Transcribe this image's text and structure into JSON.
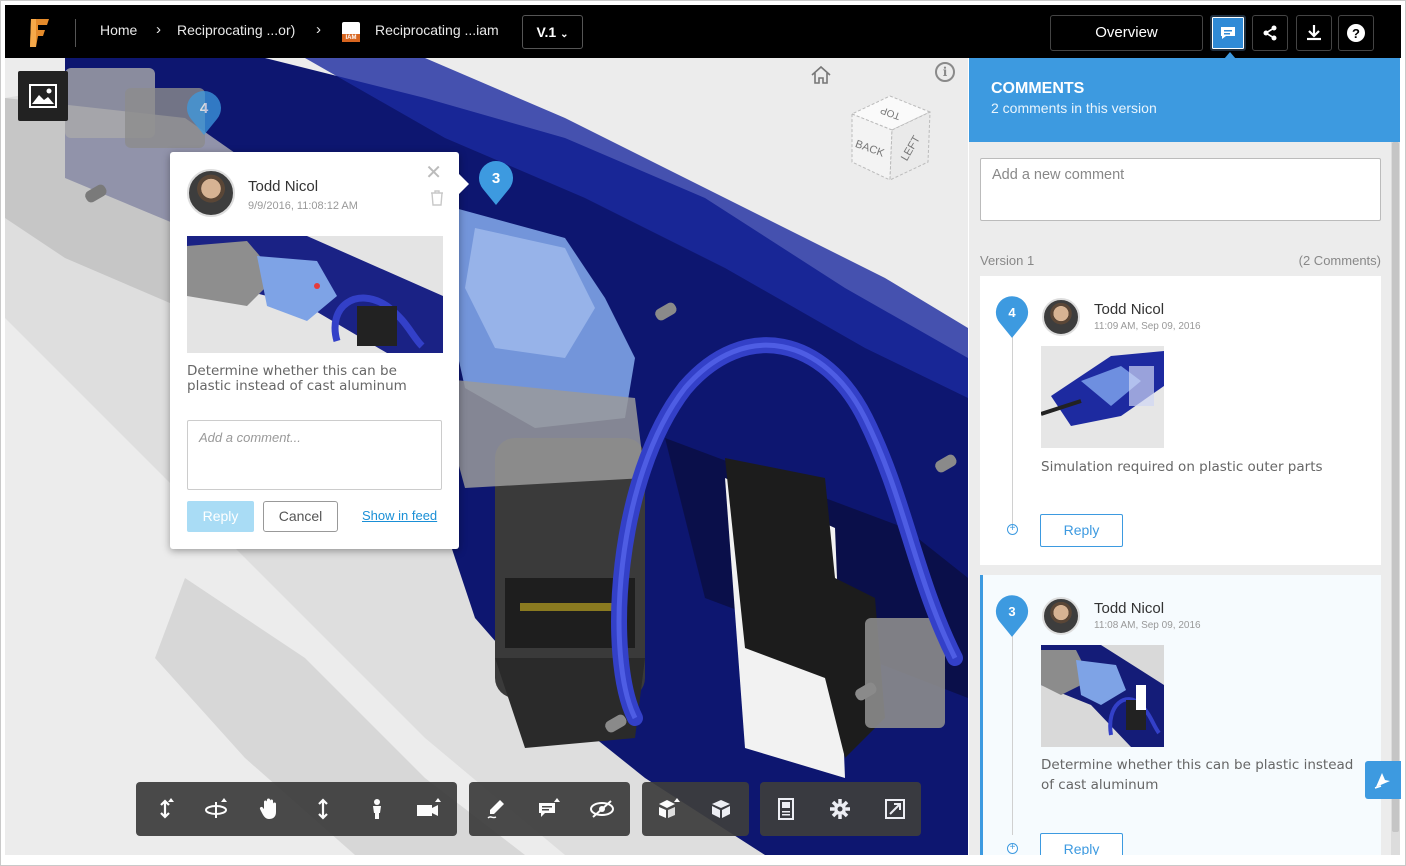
{
  "topbar": {
    "breadcrumb": [
      {
        "label": "Home"
      },
      {
        "label": "Reciprocating ...or)"
      },
      {
        "label": "Reciprocating ...iam"
      }
    ],
    "file_badge": "IAM",
    "version": "V.1",
    "overview_label": "Overview"
  },
  "viewer": {
    "viewcube": {
      "faces": [
        "TOP",
        "BACK",
        "LEFT"
      ]
    },
    "pins": [
      {
        "number": "4"
      },
      {
        "number": "3"
      }
    ],
    "popup": {
      "author": "Todd Nicol",
      "timestamp": "9/9/2016, 11:08:12 AM",
      "text": "Determine whether this can be plastic instead of cast aluminum",
      "input_placeholder": "Add a comment...",
      "reply_label": "Reply",
      "cancel_label": "Cancel",
      "show_in_feed_label": "Show in feed"
    },
    "toolbar_icons": [
      "pan-arrows-icon",
      "orbit-icon",
      "hand-icon",
      "zoom-icon",
      "person-icon",
      "camera-icon",
      "markup-pen-icon",
      "comment-icon",
      "hide-icon",
      "explode-icon",
      "model-icon",
      "properties-icon",
      "settings-icon",
      "fullscreen-icon"
    ]
  },
  "panel": {
    "title": "COMMENTS",
    "subtitle": "2 comments in this version",
    "new_comment_placeholder": "Add a new comment",
    "version_label": "Version 1",
    "version_count": "(2 Comments)",
    "comments": [
      {
        "pin": "4",
        "author": "Todd Nicol",
        "time": "11:09 AM, Sep 09, 2016",
        "text": "Simulation required on plastic outer parts",
        "reply_label": "Reply"
      },
      {
        "pin": "3",
        "author": "Todd Nicol",
        "time": "11:08 AM, Sep 09, 2016",
        "text": "Determine whether this can be plastic instead of cast aluminum",
        "reply_label": "Reply"
      }
    ]
  },
  "colors": {
    "accent": "#3d9ae0",
    "topbar": "#000000",
    "model_blue": "#0d1a7a",
    "reply_disabled": "#a9dcf5"
  }
}
